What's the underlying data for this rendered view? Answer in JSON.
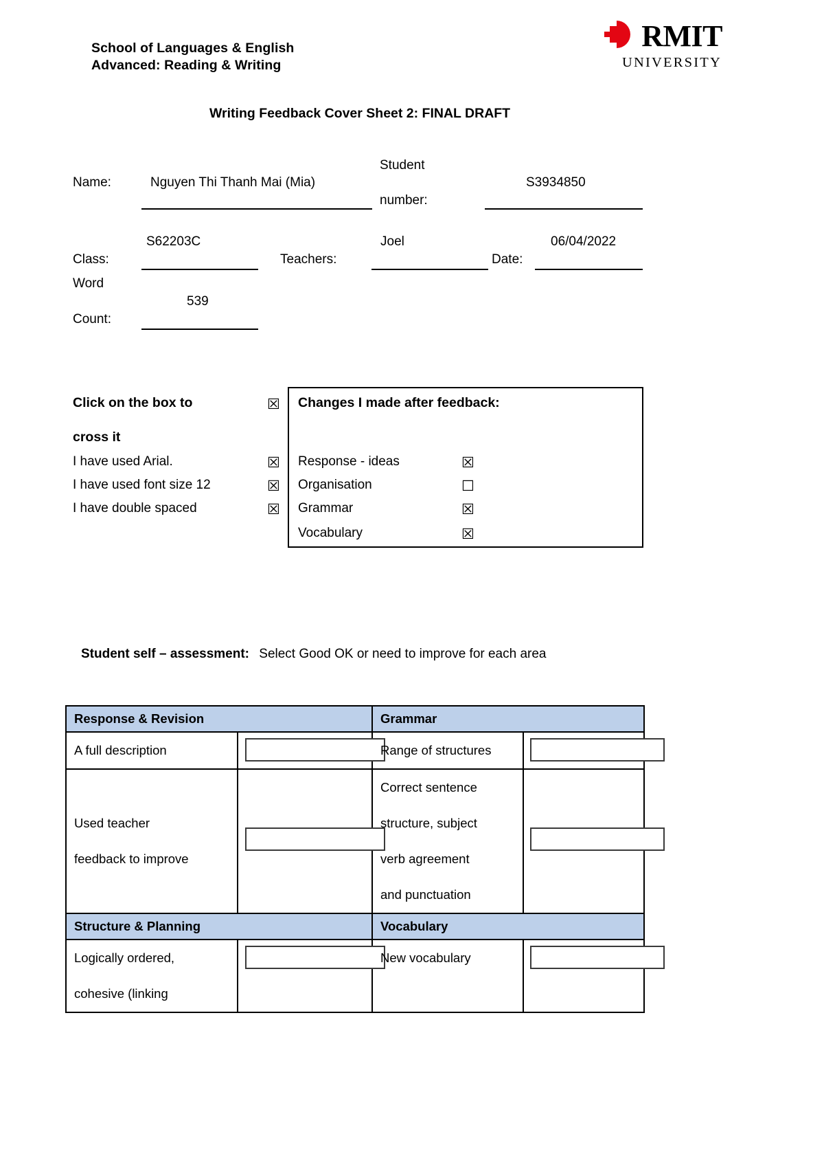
{
  "header": {
    "school": "School of Languages & English",
    "course": "Advanced: Reading & Writing",
    "logo_word": "RMIT",
    "logo_sub": "UNIVERSITY",
    "logo_red": "#E30613",
    "title": "Writing Feedback Cover Sheet 2: FINAL DRAFT"
  },
  "identity": {
    "name_label": "Name:",
    "name_value": "Nguyen Thi Thanh Mai (Mia)",
    "student_number_label_line1": "Student",
    "student_number_label_line2": "number:",
    "student_number_value": "S3934850",
    "class_label": "Class:",
    "class_value": "S62203C",
    "teachers_label": "Teachers:",
    "teachers_value": "Joel",
    "date_label": "Date:",
    "date_value": "06/04/2022",
    "word_count_label_line1": "Word",
    "word_count_label_line2": "Count:",
    "word_count_value": "539"
  },
  "checklist": {
    "heading_line1": "Click on the box to",
    "heading_line2": "cross it",
    "heading_checkbox": "☒",
    "items": [
      {
        "label": "I have used Arial.",
        "checkbox": "☒"
      },
      {
        "label": "I have used font size 12",
        "checkbox": "☒"
      },
      {
        "label": "I have double spaced",
        "checkbox": "☒"
      }
    ]
  },
  "changes": {
    "title": "Changes I made after feedback:",
    "items": [
      {
        "label": "Response - ideas",
        "checkbox": "☒"
      },
      {
        "label": "Organisation",
        "checkbox": "☐"
      },
      {
        "label": "Grammar",
        "checkbox": "☒"
      },
      {
        "label": "Vocabulary",
        "checkbox": "☒"
      }
    ]
  },
  "self_assessment": {
    "label": "Student self – assessment:",
    "instruction": "Select Good OK or need to improve for each area",
    "header_fill": "#bdd0ea",
    "sections": {
      "response": {
        "header": "Response & Revision",
        "rows": [
          {
            "criterion": "A full description",
            "value": ""
          },
          {
            "criterion": "Used teacher\nfeedback to improve",
            "value": ""
          }
        ]
      },
      "grammar": {
        "header": "Grammar",
        "rows": [
          {
            "criterion": "Range of structures",
            "value": ""
          },
          {
            "criterion": "Correct sentence\nstructure, subject\nverb agreement\nand punctuation",
            "value": ""
          }
        ]
      },
      "structure": {
        "header": "Structure & Planning",
        "rows": [
          {
            "criterion": "Logically ordered,\ncohesive (linking",
            "value": ""
          }
        ]
      },
      "vocabulary": {
        "header": "Vocabulary",
        "rows": [
          {
            "criterion": "New vocabulary",
            "value": ""
          }
        ]
      }
    }
  }
}
